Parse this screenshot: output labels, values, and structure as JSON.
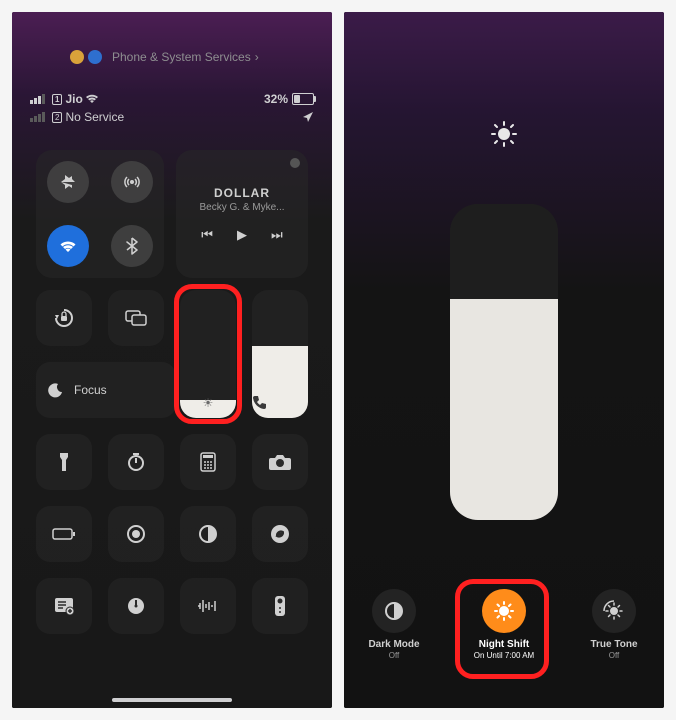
{
  "breadcrumb": "Phone & System Services",
  "status": {
    "carrier": "Jio",
    "sim1": "1",
    "sim2": "2",
    "no_service": "No Service",
    "battery": "32%"
  },
  "media": {
    "title": "DOLLAR",
    "subtitle": "Becky G. & Myke..."
  },
  "focus": {
    "label": "Focus"
  },
  "right": {
    "dark": {
      "label": "Dark Mode",
      "sub": "Off"
    },
    "night": {
      "label": "Night Shift",
      "sub": "On Until 7:00 AM"
    },
    "tone": {
      "label": "True Tone",
      "sub": "Off"
    }
  }
}
